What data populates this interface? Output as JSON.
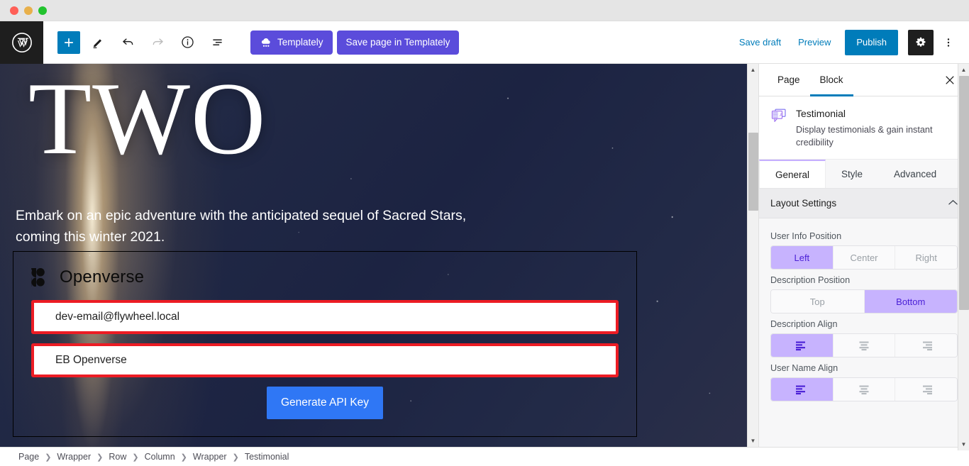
{
  "window": {
    "traffic_lights": [
      "close",
      "minimize",
      "maximize"
    ]
  },
  "toolbar": {
    "wp_logo": "wordpress-logo",
    "add_block_label": "+",
    "icons": [
      "pencil-tool-icon",
      "undo-icon",
      "redo-icon",
      "info-icon",
      "list-view-icon"
    ],
    "templately_label": "Templately",
    "save_in_templately_label": "Save page in Templately",
    "save_draft_label": "Save draft",
    "preview_label": "Preview",
    "publish_label": "Publish",
    "settings_label": "gear-icon",
    "more_label": "more-options-icon"
  },
  "canvas": {
    "hero_title": "TWO",
    "hero_subtitle": "Embark on an epic adventure with the anticipated sequel of Sacred Stars, coming this winter 2021.",
    "openverse": {
      "brand_name": "Openverse",
      "email_value": "dev-email@flywheel.local",
      "name_value": "EB Openverse",
      "generate_button_label": "Generate API Key"
    },
    "colors": {
      "field_border": "#ec1c24",
      "generate_button": "#2f77f5",
      "hero_background": "#1c2342"
    }
  },
  "sidebar": {
    "tabs": [
      {
        "label": "Page",
        "active": false
      },
      {
        "label": "Block",
        "active": true
      }
    ],
    "close_label": "✕",
    "block": {
      "icon": "testimonial-block-icon",
      "title": "Testimonial",
      "description": "Display testimonials & gain instant credibility"
    },
    "eb_tabs": [
      {
        "label": "General",
        "active": true
      },
      {
        "label": "Style",
        "active": false
      },
      {
        "label": "Advanced",
        "active": false
      }
    ],
    "panel": {
      "title": "Layout Settings",
      "collapse_icon": "chevron-up-icon",
      "controls": [
        {
          "label": "User Info Position",
          "options": [
            "Left",
            "Center",
            "Right"
          ],
          "selected": "Left"
        },
        {
          "label": "Description Position",
          "options": [
            "Top",
            "Bottom"
          ],
          "selected": "Bottom"
        },
        {
          "label": "Description Align",
          "options": [
            "align-left-icon",
            "align-center-icon",
            "align-right-icon"
          ],
          "selected": "align-left-icon"
        },
        {
          "label": "User Name Align",
          "options": [
            "align-left-icon",
            "align-center-icon",
            "align-right-icon"
          ],
          "selected": "align-left-icon"
        }
      ]
    },
    "accent_color": "#c7b3fe",
    "accent_text_color": "#4a1fd6"
  },
  "breadcrumb": {
    "separator": "❯",
    "items": [
      "Page",
      "Wrapper",
      "Row",
      "Column",
      "Wrapper",
      "Testimonial"
    ]
  }
}
